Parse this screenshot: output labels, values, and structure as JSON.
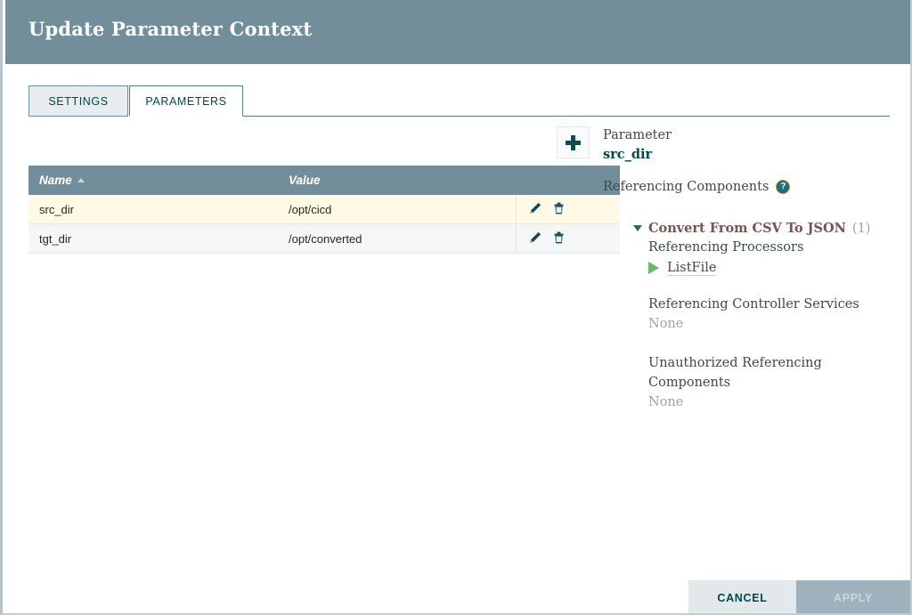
{
  "dialog": {
    "title": "Update Parameter Context"
  },
  "tabs": [
    {
      "label": "SETTINGS",
      "active": false,
      "name": "tab-settings"
    },
    {
      "label": "PARAMETERS",
      "active": true,
      "name": "tab-parameters"
    }
  ],
  "toolbar": {
    "add_label": "+",
    "add_icon": "plus-icon"
  },
  "table": {
    "columns": [
      "Name",
      "Value",
      ""
    ],
    "sort": {
      "column": "Name",
      "direction": "asc",
      "icon": "caret-up-icon"
    },
    "rows": [
      {
        "name": "src_dir",
        "value": "/opt/cicd",
        "selected": true,
        "edit_icon": "pencil-icon",
        "delete_icon": "trash-icon"
      },
      {
        "name": "tgt_dir",
        "value": "/opt/converted",
        "selected": false,
        "edit_icon": "pencil-icon",
        "delete_icon": "trash-icon"
      }
    ]
  },
  "details": {
    "parameter_label": "Parameter",
    "parameter_name": "src_dir",
    "referencing_components_label": "Referencing Components",
    "help_icon": "question-mark-icon",
    "group": {
      "name": "Convert From CSV To JSON",
      "count": "(1)",
      "expanded": true,
      "caret_icon": "caret-down-icon",
      "processors_label": "Referencing Processors",
      "processors": [
        {
          "name": "ListFile",
          "status_icon": "play-icon"
        }
      ],
      "controller_services_label": "Referencing Controller Services",
      "controller_services_value": "None",
      "unauthorized_label": "Unauthorized Referencing Components",
      "unauthorized_value": "None"
    }
  },
  "footer": {
    "cancel_label": "CANCEL",
    "apply_label": "APPLY"
  },
  "colors": {
    "header_bg": "#728e9b",
    "accent_teal": "#004849",
    "selected_row": "#fffae6",
    "group_name": "#775351",
    "play_green": "#67b96a"
  }
}
